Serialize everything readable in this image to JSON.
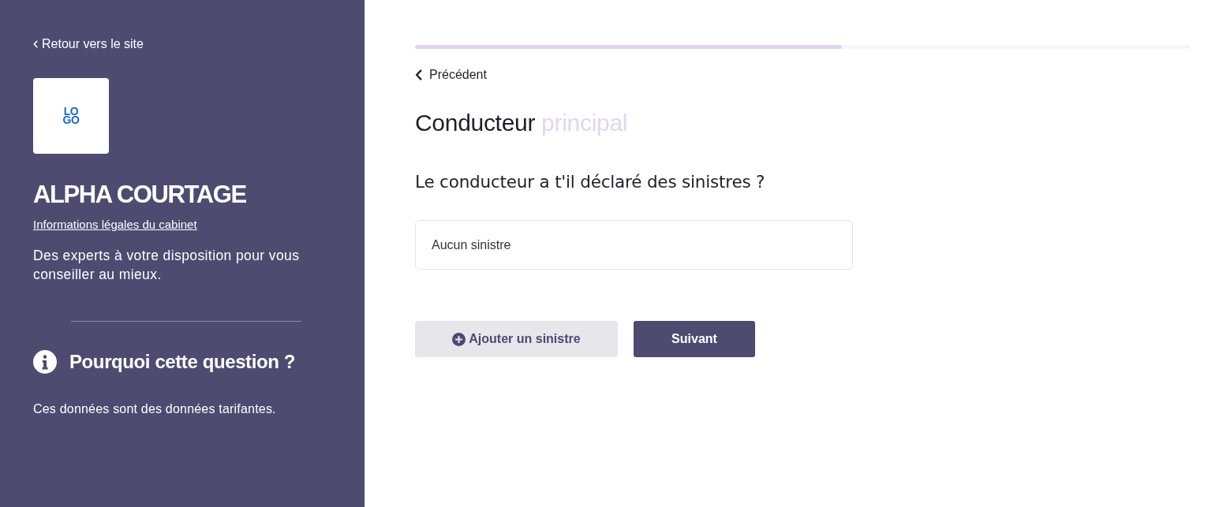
{
  "sidebar": {
    "back_link": "Retour vers le site",
    "logo": [
      "LO",
      "GO"
    ],
    "company": "ALPHA COURTAGE",
    "legal_link": "Informations légales du cabinet",
    "tagline": "Des experts à votre disposition pour vous conseiller au mieux.",
    "help": {
      "title": "Pourquoi cette question ?",
      "text": "Ces données sont des données tarifantes."
    }
  },
  "progress": {
    "level": 0.55
  },
  "back_button": "Précédent",
  "title": {
    "text": "Conducteur",
    "accent": "principal"
  },
  "question": "Le conducteur a t'il déclaré des sinistres ?",
  "claims": {
    "empty_text": "Aucun sinistre"
  },
  "buttons": [
    {
      "kind": "secondary",
      "label": "Ajouter un sinistre"
    },
    {
      "kind": "primary",
      "label": "Suivant"
    }
  ]
}
